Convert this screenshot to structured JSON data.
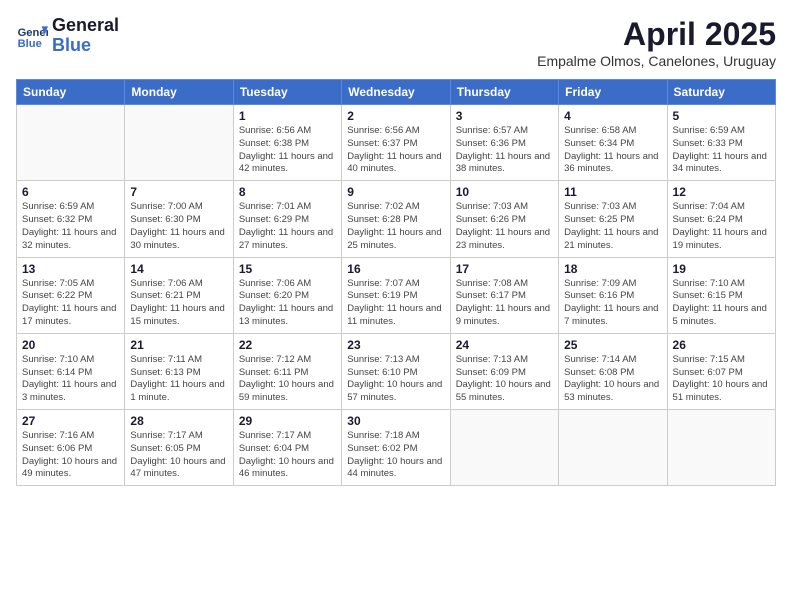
{
  "logo": {
    "line1": "General",
    "line2": "Blue"
  },
  "title": "April 2025",
  "subtitle": "Empalme Olmos, Canelones, Uruguay",
  "days_of_week": [
    "Sunday",
    "Monday",
    "Tuesday",
    "Wednesday",
    "Thursday",
    "Friday",
    "Saturday"
  ],
  "weeks": [
    [
      {
        "day": "",
        "info": ""
      },
      {
        "day": "",
        "info": ""
      },
      {
        "day": "1",
        "info": "Sunrise: 6:56 AM\nSunset: 6:38 PM\nDaylight: 11 hours and 42 minutes."
      },
      {
        "day": "2",
        "info": "Sunrise: 6:56 AM\nSunset: 6:37 PM\nDaylight: 11 hours and 40 minutes."
      },
      {
        "day": "3",
        "info": "Sunrise: 6:57 AM\nSunset: 6:36 PM\nDaylight: 11 hours and 38 minutes."
      },
      {
        "day": "4",
        "info": "Sunrise: 6:58 AM\nSunset: 6:34 PM\nDaylight: 11 hours and 36 minutes."
      },
      {
        "day": "5",
        "info": "Sunrise: 6:59 AM\nSunset: 6:33 PM\nDaylight: 11 hours and 34 minutes."
      }
    ],
    [
      {
        "day": "6",
        "info": "Sunrise: 6:59 AM\nSunset: 6:32 PM\nDaylight: 11 hours and 32 minutes."
      },
      {
        "day": "7",
        "info": "Sunrise: 7:00 AM\nSunset: 6:30 PM\nDaylight: 11 hours and 30 minutes."
      },
      {
        "day": "8",
        "info": "Sunrise: 7:01 AM\nSunset: 6:29 PM\nDaylight: 11 hours and 27 minutes."
      },
      {
        "day": "9",
        "info": "Sunrise: 7:02 AM\nSunset: 6:28 PM\nDaylight: 11 hours and 25 minutes."
      },
      {
        "day": "10",
        "info": "Sunrise: 7:03 AM\nSunset: 6:26 PM\nDaylight: 11 hours and 23 minutes."
      },
      {
        "day": "11",
        "info": "Sunrise: 7:03 AM\nSunset: 6:25 PM\nDaylight: 11 hours and 21 minutes."
      },
      {
        "day": "12",
        "info": "Sunrise: 7:04 AM\nSunset: 6:24 PM\nDaylight: 11 hours and 19 minutes."
      }
    ],
    [
      {
        "day": "13",
        "info": "Sunrise: 7:05 AM\nSunset: 6:22 PM\nDaylight: 11 hours and 17 minutes."
      },
      {
        "day": "14",
        "info": "Sunrise: 7:06 AM\nSunset: 6:21 PM\nDaylight: 11 hours and 15 minutes."
      },
      {
        "day": "15",
        "info": "Sunrise: 7:06 AM\nSunset: 6:20 PM\nDaylight: 11 hours and 13 minutes."
      },
      {
        "day": "16",
        "info": "Sunrise: 7:07 AM\nSunset: 6:19 PM\nDaylight: 11 hours and 11 minutes."
      },
      {
        "day": "17",
        "info": "Sunrise: 7:08 AM\nSunset: 6:17 PM\nDaylight: 11 hours and 9 minutes."
      },
      {
        "day": "18",
        "info": "Sunrise: 7:09 AM\nSunset: 6:16 PM\nDaylight: 11 hours and 7 minutes."
      },
      {
        "day": "19",
        "info": "Sunrise: 7:10 AM\nSunset: 6:15 PM\nDaylight: 11 hours and 5 minutes."
      }
    ],
    [
      {
        "day": "20",
        "info": "Sunrise: 7:10 AM\nSunset: 6:14 PM\nDaylight: 11 hours and 3 minutes."
      },
      {
        "day": "21",
        "info": "Sunrise: 7:11 AM\nSunset: 6:13 PM\nDaylight: 11 hours and 1 minute."
      },
      {
        "day": "22",
        "info": "Sunrise: 7:12 AM\nSunset: 6:11 PM\nDaylight: 10 hours and 59 minutes."
      },
      {
        "day": "23",
        "info": "Sunrise: 7:13 AM\nSunset: 6:10 PM\nDaylight: 10 hours and 57 minutes."
      },
      {
        "day": "24",
        "info": "Sunrise: 7:13 AM\nSunset: 6:09 PM\nDaylight: 10 hours and 55 minutes."
      },
      {
        "day": "25",
        "info": "Sunrise: 7:14 AM\nSunset: 6:08 PM\nDaylight: 10 hours and 53 minutes."
      },
      {
        "day": "26",
        "info": "Sunrise: 7:15 AM\nSunset: 6:07 PM\nDaylight: 10 hours and 51 minutes."
      }
    ],
    [
      {
        "day": "27",
        "info": "Sunrise: 7:16 AM\nSunset: 6:06 PM\nDaylight: 10 hours and 49 minutes."
      },
      {
        "day": "28",
        "info": "Sunrise: 7:17 AM\nSunset: 6:05 PM\nDaylight: 10 hours and 47 minutes."
      },
      {
        "day": "29",
        "info": "Sunrise: 7:17 AM\nSunset: 6:04 PM\nDaylight: 10 hours and 46 minutes."
      },
      {
        "day": "30",
        "info": "Sunrise: 7:18 AM\nSunset: 6:02 PM\nDaylight: 10 hours and 44 minutes."
      },
      {
        "day": "",
        "info": ""
      },
      {
        "day": "",
        "info": ""
      },
      {
        "day": "",
        "info": ""
      }
    ]
  ]
}
